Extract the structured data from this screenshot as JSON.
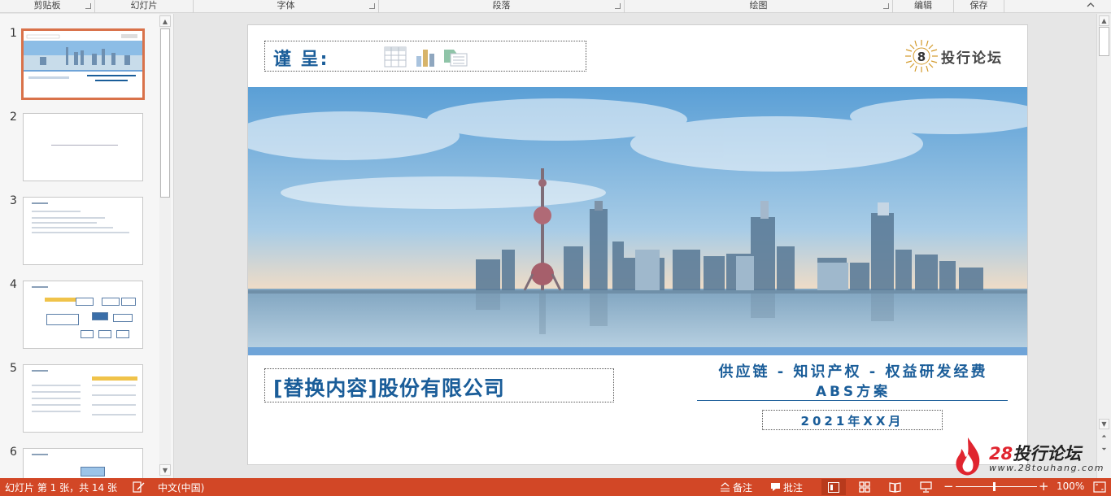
{
  "ribbon": {
    "groups": [
      {
        "label": "剪贴板"
      },
      {
        "label": "幻灯片"
      },
      {
        "label": "字体"
      },
      {
        "label": "段落"
      },
      {
        "label": "绘图"
      },
      {
        "label": "编辑"
      },
      {
        "label": "保存"
      }
    ],
    "collapse_icon": "chevron-up-icon"
  },
  "thumbnails": {
    "slides": [
      {
        "number": "1",
        "active": true
      },
      {
        "number": "2",
        "active": false
      },
      {
        "number": "3",
        "active": false
      },
      {
        "number": "4",
        "active": false
      },
      {
        "number": "5",
        "active": false
      },
      {
        "number": "6",
        "active": false
      }
    ]
  },
  "slide": {
    "header_title": "谨 呈:",
    "header_icons": [
      "table-icon",
      "chart-icon",
      "smartart-icon"
    ],
    "logo_text": "投行论坛",
    "logo_mark": "8",
    "company": "[替换内容]股份有限公司",
    "project_line1": "供应链 - 知识产权 - 权益研发经费",
    "project_line2": "ABS方案",
    "date": "2021年XX月"
  },
  "status": {
    "slide_info": "幻灯片 第 1 张，共 14 张",
    "language": "中文(中国)",
    "notes_label": "备注",
    "comments_label": "批注",
    "zoom": "100%",
    "zoom_minus": "−",
    "zoom_plus": "+"
  },
  "watermark": {
    "brand_num": "28",
    "brand_text": "投行论坛",
    "url": "www.28touhang.com"
  },
  "colors": {
    "accent": "#d24726",
    "title_blue": "#1a5d99",
    "active_thumb_border": "#d9724a"
  }
}
